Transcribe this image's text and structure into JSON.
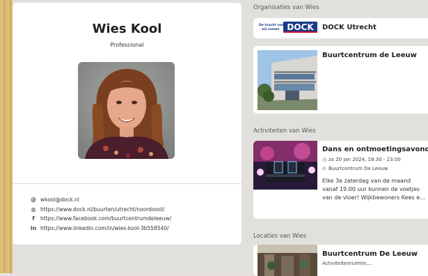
{
  "profile": {
    "name": "Wies Kool",
    "role": "Professional",
    "contacts": [
      {
        "icon": "at-icon",
        "glyph": "@",
        "text": "wkool@dock.nl"
      },
      {
        "icon": "globe-icon",
        "glyph": "◍",
        "text": "https://www.dock.nl/buurten/utrecht/noordoost/"
      },
      {
        "icon": "facebook-icon",
        "glyph": "f",
        "text": "https://www.facebook.com/buurtcentrumdeleeuw/"
      },
      {
        "icon": "linkedin-icon",
        "glyph": "in",
        "text": "https://www.linkedin.com/in/wies-kool-3b558540/"
      }
    ]
  },
  "organisations": {
    "title": "Organisaties van Wies",
    "items": [
      {
        "name": "DOCK Utrecht",
        "logo_tagline_1": "De kracht van",
        "logo_tagline_2": "wij samen",
        "logo_word": "DOCK"
      },
      {
        "name": "Buurtcentrum de Leeuw"
      }
    ]
  },
  "activities": {
    "title": "Activiteiten van Wies",
    "items": [
      {
        "name": "Dans en ontmoetingsavond",
        "datetime": "za 20 jan 2024, 18:30 - 23:00",
        "location": "Buurtcentrum De Leeuw",
        "description": "Elke 3e zaterdag van de maand vanaf 19.00 uur kunnen de voetjes van de vloer!  Wijkbewoners Kees e..."
      }
    ]
  },
  "locations": {
    "title": "Locaties van Wies",
    "items": [
      {
        "name": "Buurtcentrum De Leeuw",
        "subtitle": "Activiteitenruimte,..."
      }
    ]
  },
  "colors": {
    "brand_blue": "#1a3a8a",
    "brand_red": "#c8102e"
  }
}
